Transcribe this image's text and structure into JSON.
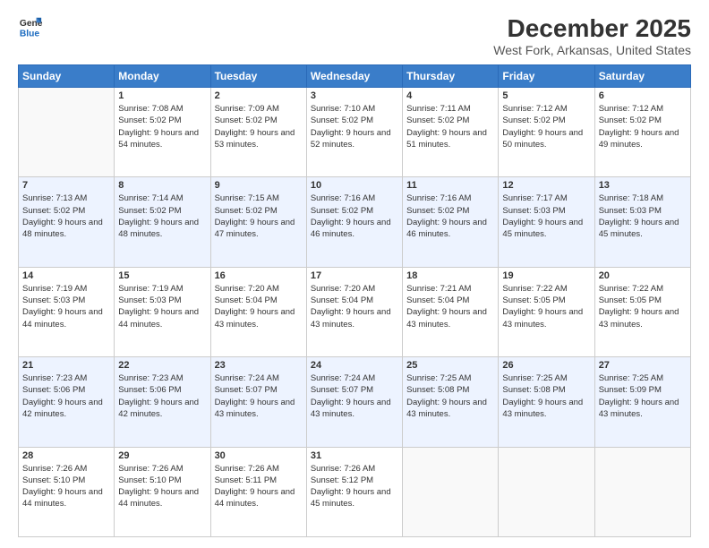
{
  "header": {
    "logo": {
      "line1": "General",
      "line2": "Blue"
    },
    "title": "December 2025",
    "subtitle": "West Fork, Arkansas, United States"
  },
  "weekdays": [
    "Sunday",
    "Monday",
    "Tuesday",
    "Wednesday",
    "Thursday",
    "Friday",
    "Saturday"
  ],
  "weeks": [
    [
      {
        "day": "",
        "sunrise": "",
        "sunset": "",
        "daylight": ""
      },
      {
        "day": "1",
        "sunrise": "Sunrise: 7:08 AM",
        "sunset": "Sunset: 5:02 PM",
        "daylight": "Daylight: 9 hours and 54 minutes."
      },
      {
        "day": "2",
        "sunrise": "Sunrise: 7:09 AM",
        "sunset": "Sunset: 5:02 PM",
        "daylight": "Daylight: 9 hours and 53 minutes."
      },
      {
        "day": "3",
        "sunrise": "Sunrise: 7:10 AM",
        "sunset": "Sunset: 5:02 PM",
        "daylight": "Daylight: 9 hours and 52 minutes."
      },
      {
        "day": "4",
        "sunrise": "Sunrise: 7:11 AM",
        "sunset": "Sunset: 5:02 PM",
        "daylight": "Daylight: 9 hours and 51 minutes."
      },
      {
        "day": "5",
        "sunrise": "Sunrise: 7:12 AM",
        "sunset": "Sunset: 5:02 PM",
        "daylight": "Daylight: 9 hours and 50 minutes."
      },
      {
        "day": "6",
        "sunrise": "Sunrise: 7:12 AM",
        "sunset": "Sunset: 5:02 PM",
        "daylight": "Daylight: 9 hours and 49 minutes."
      }
    ],
    [
      {
        "day": "7",
        "sunrise": "Sunrise: 7:13 AM",
        "sunset": "Sunset: 5:02 PM",
        "daylight": "Daylight: 9 hours and 48 minutes."
      },
      {
        "day": "8",
        "sunrise": "Sunrise: 7:14 AM",
        "sunset": "Sunset: 5:02 PM",
        "daylight": "Daylight: 9 hours and 48 minutes."
      },
      {
        "day": "9",
        "sunrise": "Sunrise: 7:15 AM",
        "sunset": "Sunset: 5:02 PM",
        "daylight": "Daylight: 9 hours and 47 minutes."
      },
      {
        "day": "10",
        "sunrise": "Sunrise: 7:16 AM",
        "sunset": "Sunset: 5:02 PM",
        "daylight": "Daylight: 9 hours and 46 minutes."
      },
      {
        "day": "11",
        "sunrise": "Sunrise: 7:16 AM",
        "sunset": "Sunset: 5:02 PM",
        "daylight": "Daylight: 9 hours and 46 minutes."
      },
      {
        "day": "12",
        "sunrise": "Sunrise: 7:17 AM",
        "sunset": "Sunset: 5:03 PM",
        "daylight": "Daylight: 9 hours and 45 minutes."
      },
      {
        "day": "13",
        "sunrise": "Sunrise: 7:18 AM",
        "sunset": "Sunset: 5:03 PM",
        "daylight": "Daylight: 9 hours and 45 minutes."
      }
    ],
    [
      {
        "day": "14",
        "sunrise": "Sunrise: 7:19 AM",
        "sunset": "Sunset: 5:03 PM",
        "daylight": "Daylight: 9 hours and 44 minutes."
      },
      {
        "day": "15",
        "sunrise": "Sunrise: 7:19 AM",
        "sunset": "Sunset: 5:03 PM",
        "daylight": "Daylight: 9 hours and 44 minutes."
      },
      {
        "day": "16",
        "sunrise": "Sunrise: 7:20 AM",
        "sunset": "Sunset: 5:04 PM",
        "daylight": "Daylight: 9 hours and 43 minutes."
      },
      {
        "day": "17",
        "sunrise": "Sunrise: 7:20 AM",
        "sunset": "Sunset: 5:04 PM",
        "daylight": "Daylight: 9 hours and 43 minutes."
      },
      {
        "day": "18",
        "sunrise": "Sunrise: 7:21 AM",
        "sunset": "Sunset: 5:04 PM",
        "daylight": "Daylight: 9 hours and 43 minutes."
      },
      {
        "day": "19",
        "sunrise": "Sunrise: 7:22 AM",
        "sunset": "Sunset: 5:05 PM",
        "daylight": "Daylight: 9 hours and 43 minutes."
      },
      {
        "day": "20",
        "sunrise": "Sunrise: 7:22 AM",
        "sunset": "Sunset: 5:05 PM",
        "daylight": "Daylight: 9 hours and 43 minutes."
      }
    ],
    [
      {
        "day": "21",
        "sunrise": "Sunrise: 7:23 AM",
        "sunset": "Sunset: 5:06 PM",
        "daylight": "Daylight: 9 hours and 42 minutes."
      },
      {
        "day": "22",
        "sunrise": "Sunrise: 7:23 AM",
        "sunset": "Sunset: 5:06 PM",
        "daylight": "Daylight: 9 hours and 42 minutes."
      },
      {
        "day": "23",
        "sunrise": "Sunrise: 7:24 AM",
        "sunset": "Sunset: 5:07 PM",
        "daylight": "Daylight: 9 hours and 43 minutes."
      },
      {
        "day": "24",
        "sunrise": "Sunrise: 7:24 AM",
        "sunset": "Sunset: 5:07 PM",
        "daylight": "Daylight: 9 hours and 43 minutes."
      },
      {
        "day": "25",
        "sunrise": "Sunrise: 7:25 AM",
        "sunset": "Sunset: 5:08 PM",
        "daylight": "Daylight: 9 hours and 43 minutes."
      },
      {
        "day": "26",
        "sunrise": "Sunrise: 7:25 AM",
        "sunset": "Sunset: 5:08 PM",
        "daylight": "Daylight: 9 hours and 43 minutes."
      },
      {
        "day": "27",
        "sunrise": "Sunrise: 7:25 AM",
        "sunset": "Sunset: 5:09 PM",
        "daylight": "Daylight: 9 hours and 43 minutes."
      }
    ],
    [
      {
        "day": "28",
        "sunrise": "Sunrise: 7:26 AM",
        "sunset": "Sunset: 5:10 PM",
        "daylight": "Daylight: 9 hours and 44 minutes."
      },
      {
        "day": "29",
        "sunrise": "Sunrise: 7:26 AM",
        "sunset": "Sunset: 5:10 PM",
        "daylight": "Daylight: 9 hours and 44 minutes."
      },
      {
        "day": "30",
        "sunrise": "Sunrise: 7:26 AM",
        "sunset": "Sunset: 5:11 PM",
        "daylight": "Daylight: 9 hours and 44 minutes."
      },
      {
        "day": "31",
        "sunrise": "Sunrise: 7:26 AM",
        "sunset": "Sunset: 5:12 PM",
        "daylight": "Daylight: 9 hours and 45 minutes."
      },
      {
        "day": "",
        "sunrise": "",
        "sunset": "",
        "daylight": ""
      },
      {
        "day": "",
        "sunrise": "",
        "sunset": "",
        "daylight": ""
      },
      {
        "day": "",
        "sunrise": "",
        "sunset": "",
        "daylight": ""
      }
    ]
  ]
}
